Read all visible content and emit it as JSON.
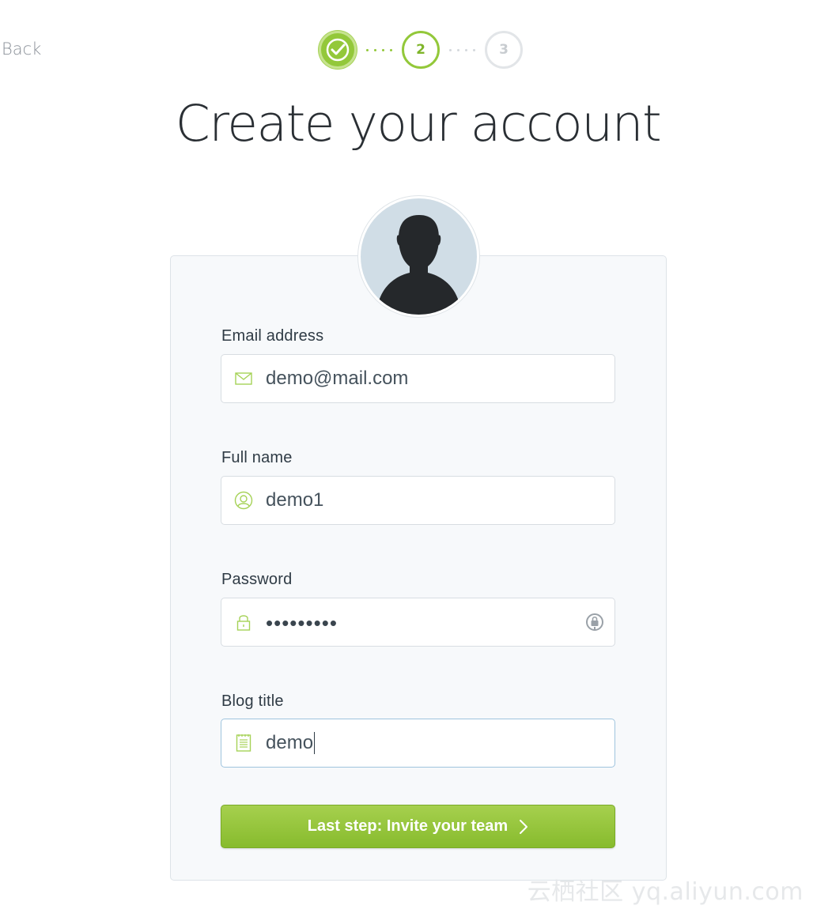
{
  "nav": {
    "back_label": "Back"
  },
  "stepper": {
    "steps": [
      {
        "label": "",
        "state": "done"
      },
      {
        "label": "2",
        "state": "current"
      },
      {
        "label": "3",
        "state": "upcoming"
      }
    ]
  },
  "page": {
    "title": "Create your account"
  },
  "form": {
    "avatar_icon": "user-silhouette-icon",
    "email": {
      "label": "Email address",
      "value": "demo@mail.com",
      "icon": "envelope-icon"
    },
    "full_name": {
      "label": "Full name",
      "value": "demo1",
      "icon": "user-icon"
    },
    "password": {
      "label": "Password",
      "value": "•••••••••",
      "icon": "lock-icon",
      "reveal_icon": "password-keychain-icon"
    },
    "blog_title": {
      "label": "Blog title",
      "value": "demo",
      "icon": "notepad-icon"
    },
    "submit_label": "Last step: Invite your team",
    "submit_icon": "chevron-right-icon"
  },
  "watermark": "云栖社区 yq.aliyun.com",
  "colors": {
    "accent": "#93c83a",
    "card_bg": "#f7f9fb",
    "text": "#2f3b45"
  }
}
